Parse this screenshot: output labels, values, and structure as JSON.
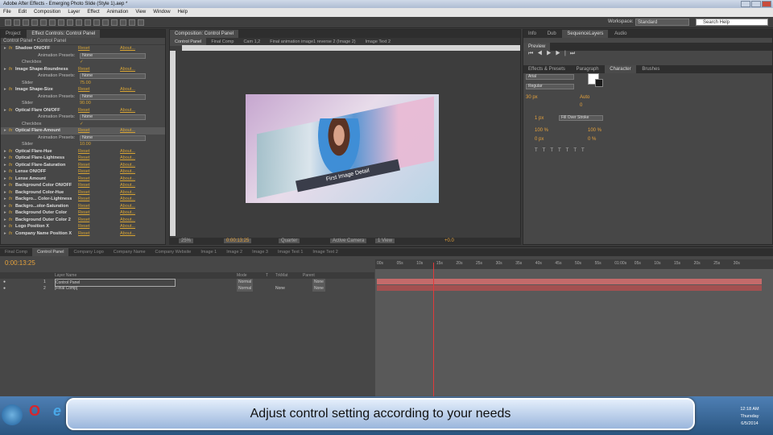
{
  "window": {
    "title": "Adobe After Effects - Emerging Photo Slide (Style 1).aep *"
  },
  "menu": [
    "File",
    "Edit",
    "Composition",
    "Layer",
    "Effect",
    "Animation",
    "View",
    "Window",
    "Help"
  ],
  "workspace": {
    "label": "Workspace:",
    "value": "Standard",
    "help_placeholder": "Search Help"
  },
  "left_panel": {
    "tabs": [
      "Project",
      "Effect Controls: Control Panel"
    ],
    "subtitle": "Control Panel • Control Panel",
    "effects": [
      {
        "name": "Shadow ON/OFF",
        "kind": "fx"
      },
      {
        "name": "Checkbox",
        "kind": "param",
        "value": "✓"
      },
      {
        "name": "Image Shape-Roundness",
        "kind": "fx"
      },
      {
        "name": "Slider",
        "kind": "param",
        "value": "75.00"
      },
      {
        "name": "Image Shape-Size",
        "kind": "fx"
      },
      {
        "name": "Slider",
        "kind": "param",
        "value": "90.00"
      },
      {
        "name": "Optical Flare ON/OFF",
        "kind": "fx"
      },
      {
        "name": "Checkbox",
        "kind": "param",
        "value": "✓"
      },
      {
        "name": "Optical Flare-Amount",
        "kind": "fx",
        "hl": true
      },
      {
        "name": "Slider",
        "kind": "param",
        "value": "10.00"
      },
      {
        "name": "Optical Flare-Hue",
        "kind": "fx"
      },
      {
        "name": "Optical Flare-Lightness",
        "kind": "fx"
      },
      {
        "name": "Optical Flare-Saturation",
        "kind": "fx"
      },
      {
        "name": "Lense ON/OFF",
        "kind": "fx"
      },
      {
        "name": "Lense Amount",
        "kind": "fx"
      },
      {
        "name": "Background Color ON/OFF",
        "kind": "fx"
      },
      {
        "name": "Background Color-Hue",
        "kind": "fx"
      },
      {
        "name": "Backgro... Color-Lightness",
        "kind": "fx"
      },
      {
        "name": "Backgro...olor-Saturation",
        "kind": "fx"
      },
      {
        "name": "Background Outer Color",
        "kind": "fx"
      },
      {
        "name": "Background Outer Color 2",
        "kind": "fx"
      },
      {
        "name": "Logo Position X",
        "kind": "fx"
      },
      {
        "name": "Company Name Position X",
        "kind": "fx"
      }
    ],
    "reset": "Reset",
    "about": "About...",
    "presets_label": "Animation Presets:",
    "presets_value": "None"
  },
  "composition": {
    "header": "Composition: Control Panel",
    "tabs": [
      "Control Panel",
      "Final Comp",
      "Cam 1,2",
      "Final animation image1 reverse 2 (Image 2)",
      "Image Text 2"
    ],
    "caption": "First Image Detail",
    "zoom": "25%",
    "timecode": "0:00:13:25",
    "quality": "Quarter",
    "camera": "Active Camera",
    "views": "1 View",
    "exposure": "+0.0"
  },
  "right_panel": {
    "tabs_top": [
      "Info",
      "Dub",
      "SequenceLayers",
      "Audio"
    ],
    "preview_tab": "Preview",
    "tabs_mid": [
      "Effects & Presets",
      "Paragraph",
      "Character",
      "Brushes"
    ],
    "font": "Arial",
    "style": "Regular",
    "size": "30 px",
    "leading": "Auto",
    "tracking": "0",
    "stroke": "1 px",
    "stroke_mode": "Fill Over Stroke",
    "scale_v": "100 %",
    "scale_h": "100 %",
    "baseline": "0 px",
    "tsume": "0 %"
  },
  "timeline": {
    "tabs": [
      "Final Comp",
      "Control Panel",
      "Company Logo",
      "Company Name",
      "Company Website",
      "Image 1",
      "Image 2",
      "Image 3",
      "Image Text 1",
      "Image Text 2"
    ],
    "timecode": "0:00:13:25",
    "columns": [
      "Layer Name",
      "Mode",
      "T",
      "TrkMat",
      "Parent"
    ],
    "layers": [
      {
        "num": "1",
        "name": "Control Panel",
        "mode": "Normal",
        "trkmat": "",
        "parent": "None"
      },
      {
        "num": "2",
        "name": "[Final Comp]",
        "mode": "Normal",
        "trkmat": "None",
        "parent": "None"
      }
    ],
    "ruler": [
      "00s",
      "05s",
      "10s",
      "15s",
      "20s",
      "25s",
      "30s",
      "35s",
      "40s",
      "45s",
      "50s",
      "55s",
      "01:00s",
      "05s",
      "10s",
      "15s",
      "20s",
      "25s",
      "30s"
    ]
  },
  "taskbar": {
    "banner": "Adjust control setting according to your needs",
    "time": "12:18 AM",
    "day": "Thursday",
    "date": "6/5/2014"
  }
}
